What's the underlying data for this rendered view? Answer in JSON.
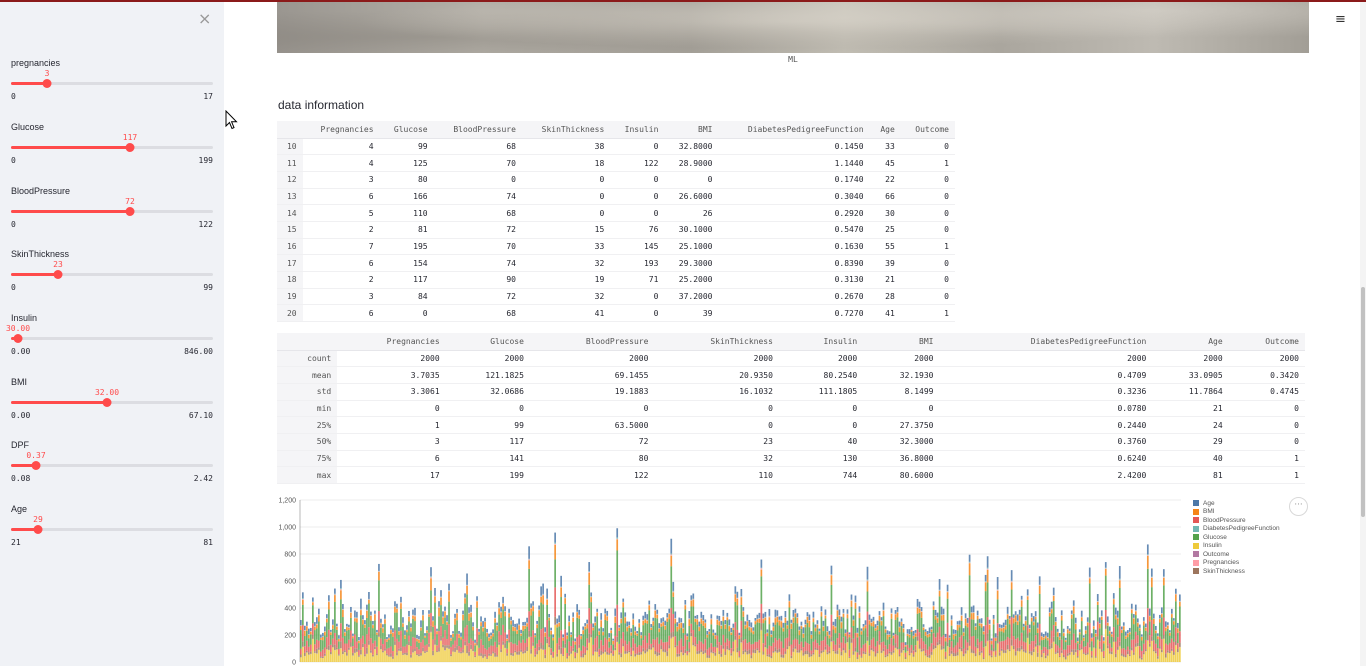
{
  "sidebar": {
    "sliders": [
      {
        "label": "pregnancies",
        "value": "3",
        "min": "0",
        "max": "17",
        "fraction": 0.176
      },
      {
        "label": "Glucose",
        "value": "117",
        "min": "0",
        "max": "199",
        "fraction": 0.588
      },
      {
        "label": "BloodPressure",
        "value": "72",
        "min": "0",
        "max": "122",
        "fraction": 0.59
      },
      {
        "label": "SkinThickness",
        "value": "23",
        "min": "0",
        "max": "99",
        "fraction": 0.232
      },
      {
        "label": "Insulin",
        "value": "30.00",
        "min": "0.00",
        "max": "846.00",
        "fraction": 0.035
      },
      {
        "label": "BMI",
        "value": "32.00",
        "min": "0.00",
        "max": "67.10",
        "fraction": 0.477
      },
      {
        "label": "DPF",
        "value": "0.37",
        "min": "0.08",
        "max": "2.42",
        "fraction": 0.124
      },
      {
        "label": "Age",
        "value": "29",
        "min": "21",
        "max": "81",
        "fraction": 0.133
      }
    ]
  },
  "main": {
    "image_caption": "ML",
    "section_title": "data information",
    "data_table": {
      "columns": [
        "Pregnancies",
        "Glucose",
        "BloodPressure",
        "SkinThickness",
        "Insulin",
        "BMI",
        "DiabetesPedigreeFunction",
        "Age",
        "Outcome"
      ],
      "rows": [
        [
          "10",
          "4",
          "99",
          "68",
          "38",
          "0",
          "32.8000",
          "0.1450",
          "33",
          "0"
        ],
        [
          "11",
          "4",
          "125",
          "70",
          "18",
          "122",
          "28.9000",
          "1.1440",
          "45",
          "1"
        ],
        [
          "12",
          "3",
          "80",
          "0",
          "0",
          "0",
          "0",
          "0.1740",
          "22",
          "0"
        ],
        [
          "13",
          "6",
          "166",
          "74",
          "0",
          "0",
          "26.6000",
          "0.3040",
          "66",
          "0"
        ],
        [
          "14",
          "5",
          "110",
          "68",
          "0",
          "0",
          "26",
          "0.2920",
          "30",
          "0"
        ],
        [
          "15",
          "2",
          "81",
          "72",
          "15",
          "76",
          "30.1000",
          "0.5470",
          "25",
          "0"
        ],
        [
          "16",
          "7",
          "195",
          "70",
          "33",
          "145",
          "25.1000",
          "0.1630",
          "55",
          "1"
        ],
        [
          "17",
          "6",
          "154",
          "74",
          "32",
          "193",
          "29.3000",
          "0.8390",
          "39",
          "0"
        ],
        [
          "18",
          "2",
          "117",
          "90",
          "19",
          "71",
          "25.2000",
          "0.3130",
          "21",
          "0"
        ],
        [
          "19",
          "3",
          "84",
          "72",
          "32",
          "0",
          "37.2000",
          "0.2670",
          "28",
          "0"
        ],
        [
          "20",
          "6",
          "0",
          "68",
          "41",
          "0",
          "39",
          "0.7270",
          "41",
          "1"
        ]
      ]
    },
    "describe_table": {
      "columns": [
        "Pregnancies",
        "Glucose",
        "BloodPressure",
        "SkinThickness",
        "Insulin",
        "BMI",
        "DiabetesPedigreeFunction",
        "Age",
        "Outcome"
      ],
      "rows": [
        [
          "count",
          "2000",
          "2000",
          "2000",
          "2000",
          "2000",
          "2000",
          "2000",
          "2000",
          "2000"
        ],
        [
          "mean",
          "3.7035",
          "121.1825",
          "69.1455",
          "20.9350",
          "80.2540",
          "32.1930",
          "0.4709",
          "33.0905",
          "0.3420"
        ],
        [
          "std",
          "3.3061",
          "32.0686",
          "19.1883",
          "16.1032",
          "111.1805",
          "8.1499",
          "0.3236",
          "11.7864",
          "0.4745"
        ],
        [
          "min",
          "0",
          "0",
          "0",
          "0",
          "0",
          "0",
          "0.0780",
          "21",
          "0"
        ],
        [
          "25%",
          "1",
          "99",
          "63.5000",
          "0",
          "0",
          "27.3750",
          "0.2440",
          "24",
          "0"
        ],
        [
          "50%",
          "3",
          "117",
          "72",
          "23",
          "40",
          "32.3000",
          "0.3760",
          "29",
          "0"
        ],
        [
          "75%",
          "6",
          "141",
          "80",
          "32",
          "130",
          "36.8000",
          "0.6240",
          "40",
          "1"
        ],
        [
          "max",
          "17",
          "199",
          "122",
          "110",
          "744",
          "80.6000",
          "2.4200",
          "81",
          "1"
        ]
      ]
    }
  },
  "chart_data": {
    "type": "bar",
    "stacked": true,
    "y_ticks": [
      "0",
      "200",
      "400",
      "600",
      "800",
      "1,000",
      "1,200"
    ],
    "ylim": [
      0,
      1200
    ],
    "legend": "top-right",
    "series": [
      {
        "name": "Age",
        "color": "#4c78a8"
      },
      {
        "name": "BMI",
        "color": "#f58518"
      },
      {
        "name": "BloodPressure",
        "color": "#e45756"
      },
      {
        "name": "DiabetesPedigreeFunction",
        "color": "#72b7b2"
      },
      {
        "name": "Glucose",
        "color": "#54a24b"
      },
      {
        "name": "Insulin",
        "color": "#eeca3b"
      },
      {
        "name": "Outcome",
        "color": "#b279a2"
      },
      {
        "name": "Pregnancies",
        "color": "#ff9da6"
      },
      {
        "name": "SkinThickness",
        "color": "#9d755d"
      }
    ]
  },
  "icons": {
    "close": "×",
    "menu": "≡",
    "more": "···"
  }
}
